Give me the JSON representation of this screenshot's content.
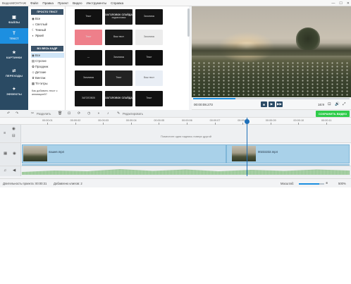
{
  "app": {
    "title": "ВидеоМОНТАЖ",
    "menu": [
      "Файл",
      "Правка",
      "Проект",
      "Видео",
      "Инструменты",
      "Справка"
    ],
    "window_controls": [
      "—",
      "☐",
      "✕"
    ]
  },
  "leftnav": [
    {
      "label": "ФАЙЛЫ",
      "icon": "▣",
      "active": false
    },
    {
      "label": "ТЕКСТ",
      "icon": "T",
      "active": true
    },
    {
      "label": "КАРТИНКИ",
      "icon": "★",
      "active": false
    },
    {
      "label": "ПЕРЕХОДЫ",
      "icon": "⇄",
      "active": false
    },
    {
      "label": "ЭФФЕКТЫ",
      "icon": "✦",
      "active": false
    }
  ],
  "categories": {
    "simple_header": "ПРОСТО ТЕКСТ",
    "simple_items": [
      {
        "label": "Все",
        "icon": "◉",
        "selected": false
      },
      {
        "label": "Светлый",
        "icon": "☼",
        "selected": false
      },
      {
        "label": "Темный",
        "icon": "☾",
        "selected": false
      },
      {
        "label": "Яркий",
        "icon": "◐",
        "selected": false
      }
    ],
    "fullframe_header": "ВО ВЕСЬ КАДР",
    "fullframe_items": [
      {
        "label": "Все",
        "icon": "◉",
        "selected": true
      },
      {
        "label": "Строгие",
        "icon": "▤",
        "selected": false
      },
      {
        "label": "Праздник",
        "icon": "✿",
        "selected": false
      },
      {
        "label": "Детские",
        "icon": "☺",
        "selected": false
      },
      {
        "label": "Винтаж",
        "icon": "♛",
        "selected": false
      },
      {
        "label": "Тit-титры",
        "icon": "▦",
        "selected": false
      }
    ],
    "help": "Как добавить текст с анимацией?"
  },
  "thumbnails": [
    {
      "bg": "#111111",
      "big": "",
      "small": "Текст"
    },
    {
      "bg": "#1c1c1c",
      "big": "ЗАГОЛОВОК СЛАЙДА",
      "small": "подзаголовок"
    },
    {
      "bg": "#151515",
      "big": "",
      "small": "Заголовок"
    },
    {
      "bg": "#ee7f8a",
      "big": "",
      "small": "Текст"
    },
    {
      "bg": "#1a1a1a",
      "big": "",
      "small": "Ваш текст"
    },
    {
      "bg": "#ececec",
      "big": "",
      "small": "Заголовок"
    },
    {
      "bg": "#111111",
      "big": "",
      "small": "—"
    },
    {
      "bg": "#181818",
      "big": "",
      "small": "Заголовок"
    },
    {
      "bg": "#101010",
      "big": "",
      "small": "Текст"
    },
    {
      "bg": "#141414",
      "big": "",
      "small": "Заголовок"
    },
    {
      "bg": "#222222",
      "big": "",
      "small": "Текст"
    },
    {
      "bg": "#e9eef5",
      "big": "",
      "small": "Ваш текст"
    },
    {
      "bg": "#131313",
      "big": "",
      "small": "ЗАГОЛОВОК"
    },
    {
      "bg": "#171717",
      "big": "ЗАГОЛОВОК СЛАЙДА",
      "small": ""
    },
    {
      "bg": "#111111",
      "big": "",
      "small": "Текст"
    }
  ],
  "player": {
    "timecode": "00:00:08.273",
    "progress": 0.27,
    "buttons": [
      "■",
      "▶",
      "▶▶"
    ],
    "ratio": "16:9",
    "right_icons": [
      "⊡",
      "🔊",
      "⤢"
    ]
  },
  "toolbar": {
    "undo": "↶",
    "redo": "↷",
    "split": "Разделить",
    "edit": "Редактировать",
    "save": "СОХРАНИТЬ ВИДЕО"
  },
  "ruler": [
    "00:00:01",
    "00:00:02",
    "00:00:03",
    "00:00:04",
    "00:00:05",
    "00:00:06",
    "00:00:07",
    "00:00:08",
    "00:00:09",
    "00:00:10",
    "00:00:11"
  ],
  "timeline": {
    "text_hint": "Поместите одни надпись поверх другой",
    "clips": [
      {
        "name": "пашня.mp4"
      },
      {
        "name": "00232232.mp4"
      }
    ]
  },
  "status": {
    "duration_label": "Длительность проекта:",
    "duration": "00:00:31",
    "clips_label": "Добавлено клипов: 2",
    "scale_label": "Масштаб:",
    "scale": "500%",
    "scale_level": 0.8
  }
}
